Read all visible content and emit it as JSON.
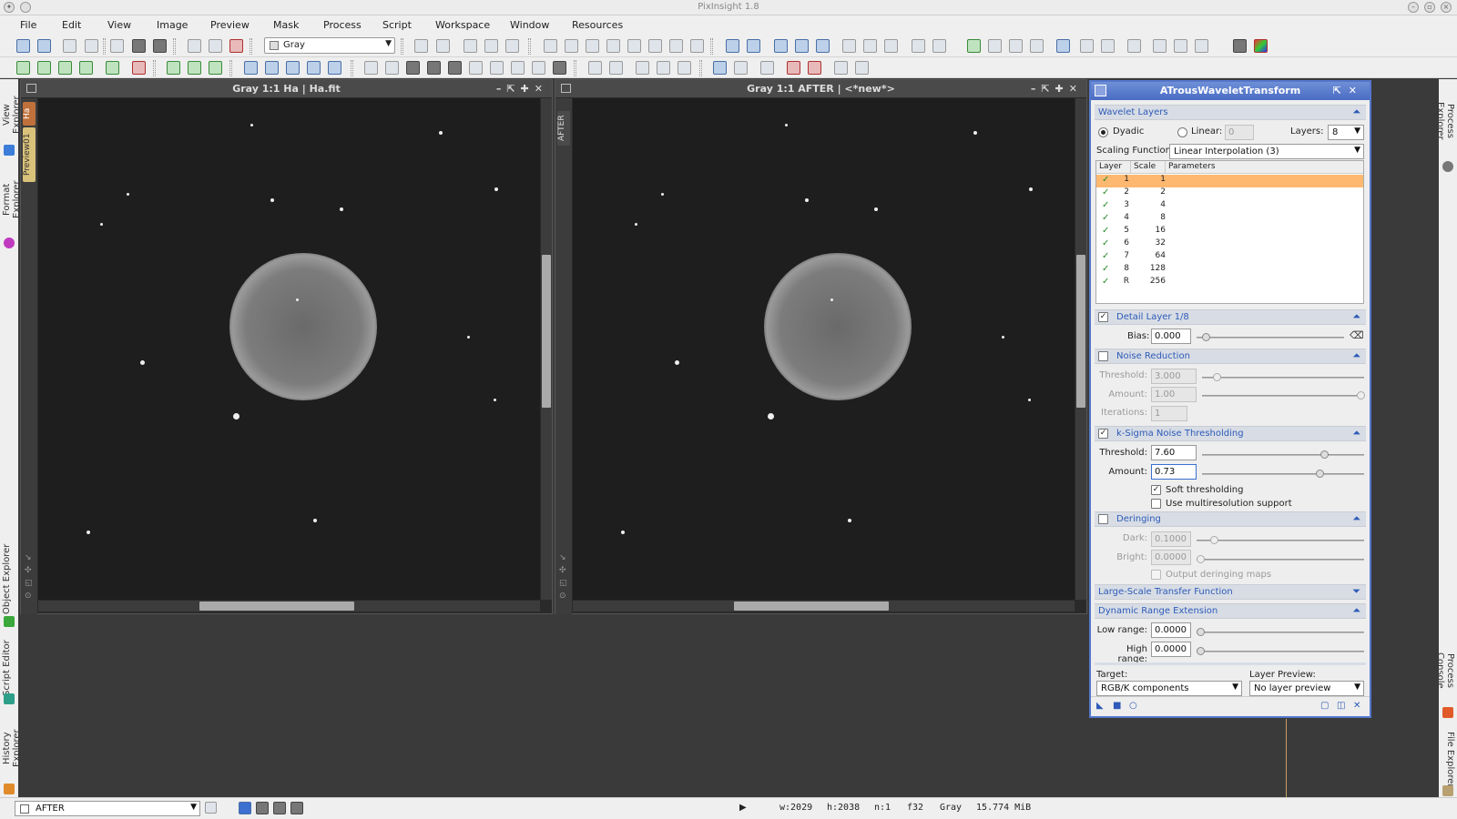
{
  "app": {
    "title": "PixInsight 1.8"
  },
  "menu": [
    "File",
    "Edit",
    "View",
    "Image",
    "Preview",
    "Mask",
    "Process",
    "Script",
    "Workspace",
    "Window",
    "Resources"
  ],
  "toolbar": {
    "colorspace_combo": "Gray"
  },
  "left_dock": {
    "tabs": [
      "View Explorer",
      "Format Explorer",
      "Object Explorer",
      "Script Editor",
      "History Explorer"
    ]
  },
  "right_dock": {
    "tabs": [
      "Process Explorer",
      "Process Console",
      "File Explorer"
    ]
  },
  "window_left": {
    "title": "Gray 1:1 Ha | Ha.fit",
    "tabs": [
      "Ha",
      "Preview01"
    ]
  },
  "window_right": {
    "title": "Gray 1:1 AFTER | <*new*>",
    "tabs": [
      "AFTER"
    ]
  },
  "panel": {
    "title": "ATrousWaveletTransform",
    "wavelet_layers": {
      "header": "Wavelet Layers",
      "dyadic_label": "Dyadic",
      "linear_label": "Linear:",
      "linear_value": "0",
      "layers_label": "Layers:",
      "layers_value": "8",
      "scaling_label": "Scaling Function:",
      "scaling_value": "Linear Interpolation (3)",
      "columns": [
        "Layer",
        "Scale",
        "Parameters"
      ],
      "rows": [
        {
          "layer": "1",
          "scale": "1"
        },
        {
          "layer": "2",
          "scale": "2"
        },
        {
          "layer": "3",
          "scale": "4"
        },
        {
          "layer": "4",
          "scale": "8"
        },
        {
          "layer": "5",
          "scale": "16"
        },
        {
          "layer": "6",
          "scale": "32"
        },
        {
          "layer": "7",
          "scale": "64"
        },
        {
          "layer": "8",
          "scale": "128"
        },
        {
          "layer": "R",
          "scale": "256"
        }
      ]
    },
    "detail": {
      "header": "Detail Layer 1/8",
      "bias_label": "Bias:",
      "bias_value": "0.000"
    },
    "noise": {
      "header": "Noise Reduction",
      "threshold_label": "Threshold:",
      "threshold_value": "3.000",
      "amount_label": "Amount:",
      "amount_value": "1.00",
      "iterations_label": "Iterations:",
      "iterations_value": "1"
    },
    "ksigma": {
      "header": "k-Sigma Noise Thresholding",
      "threshold_label": "Threshold:",
      "threshold_value": "7.60",
      "amount_label": "Amount:",
      "amount_value": "0.73",
      "soft_label": "Soft thresholding",
      "multi_label": "Use multiresolution support"
    },
    "deringing": {
      "header": "Deringing",
      "dark_label": "Dark:",
      "dark_value": "0.1000",
      "bright_label": "Bright:",
      "bright_value": "0.0000",
      "output_label": "Output deringing maps"
    },
    "lstf": {
      "header": "Large-Scale Transfer Function"
    },
    "dre": {
      "header": "Dynamic Range Extension",
      "low_label": "Low range:",
      "low_value": "0.0000",
      "high_label": "High range:",
      "high_value": "0.0000"
    },
    "target_label": "Target:",
    "target_value": "RGB/K components",
    "preview_label": "Layer Preview:",
    "preview_value": "No layer preview"
  },
  "status": {
    "view": "AFTER",
    "width": "w:2029",
    "height": "h:2038",
    "channels": "n:1",
    "sample": "f32",
    "colorspace": "Gray",
    "size": "15.774 MiB"
  },
  "colors": {
    "panel_accent": "#4a6cc4",
    "selected_row": "#ffb870",
    "section_text": "#2d5ab8"
  }
}
